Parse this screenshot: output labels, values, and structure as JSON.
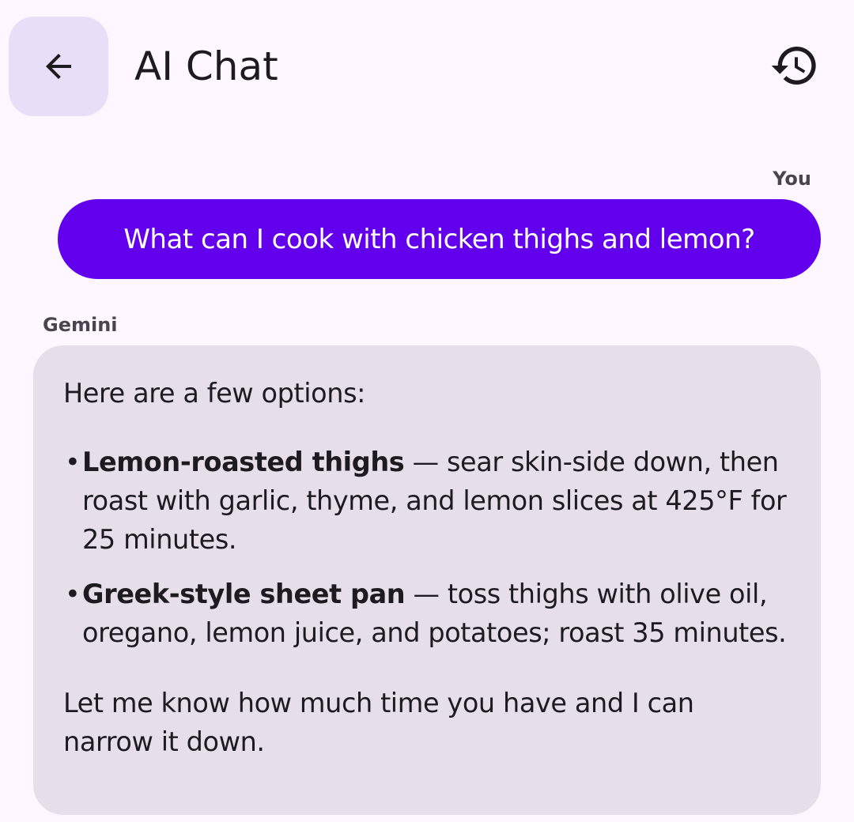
{
  "header": {
    "title": "AI Chat",
    "back_icon": "arrow-back-icon",
    "history_icon": "history-icon"
  },
  "colors": {
    "background": "#FEF7FF",
    "back_button_bg": "#E8DEF8",
    "user_bubble": "#6200EE",
    "ai_bubble": "#E6DFEA",
    "label": "#49454F"
  },
  "messages": {
    "user": {
      "sender": "You",
      "text": "What can I cook with chicken thighs and lemon?"
    },
    "ai": {
      "sender": "Gemini",
      "intro": "Here are a few options:",
      "items": [
        {
          "title": "Lemon-roasted thighs",
          "body": "sear skin-side down, then roast with garlic, thyme, and  lemon slices at 425°F for 25 minutes."
        },
        {
          "title": "Greek-style sheet pan",
          "body": "toss thighs with olive oil, oregano, lemon juice, and  potatoes; roast 35 minutes."
        }
      ],
      "separator": "—",
      "bullet": "•",
      "closing": "Let me know how much time you have and I can narrow it down."
    }
  }
}
